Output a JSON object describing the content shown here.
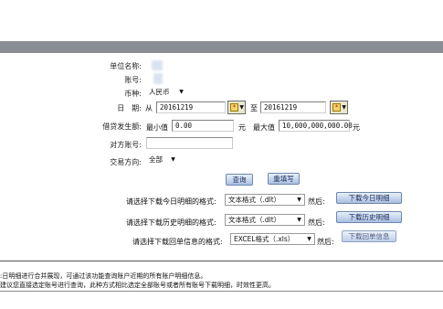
{
  "form": {
    "unit_name_label": "单位名称:",
    "account_label": "账号:",
    "currency_label": "币种:",
    "currency_value": "人民币",
    "date_label": "日　期:",
    "date_from_label": "从",
    "date_from_value": "20161219",
    "date_to_label": "至",
    "date_to_value": "20161219",
    "amount_label": "借贷发生额:",
    "min_label": "最小值",
    "min_value": "0.00",
    "yuan1": "元",
    "max_label": "最大值",
    "max_value": "10,000,000,000.00",
    "yuan2": "元",
    "counter_account_label": "对方账号:",
    "direction_label": "交易方向:",
    "direction_value": "全部"
  },
  "actions": {
    "query_label": "查询",
    "reset_label": "重填写"
  },
  "downloads": [
    {
      "prompt": "请选择下载今日明细的格式:",
      "format": "文本格式（.dlt）",
      "then": "然后:",
      "button": "下载今日明细"
    },
    {
      "prompt": "请选择下载历史明细的格式:",
      "format": "文本格式（.dlt）",
      "then": "然后:",
      "button": "下载历史明细"
    },
    {
      "prompt": "请选择下载回单信息的格式:",
      "format": "EXCEL格式（.xls）",
      "then": "然后:",
      "button": "下载回单信息"
    }
  ],
  "notes": {
    "line1": ":日明细进行合并展现，可通过该功能查询账户近期的所有账户明细信息。",
    "line2": "建议您直接选定账号进行查询，此种方式相比选定全部账号或者所有账号下载明细，时效性更高。"
  }
}
